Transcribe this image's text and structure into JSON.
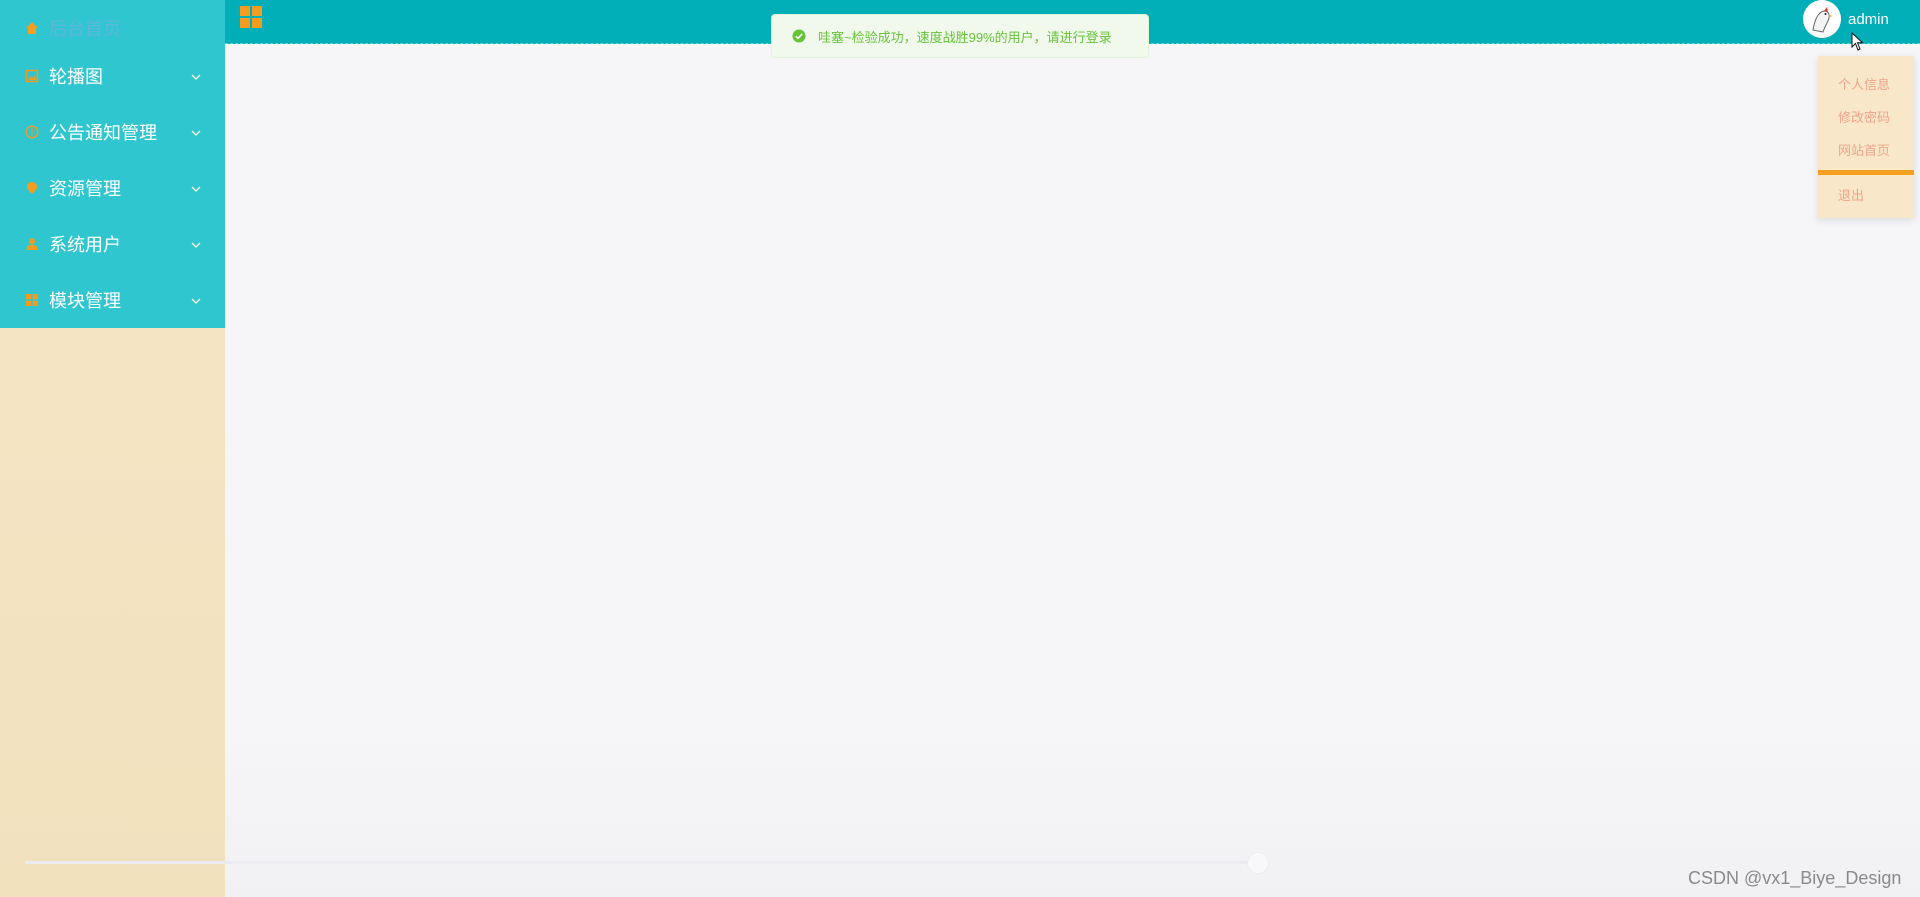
{
  "sidebar": {
    "items": [
      {
        "label": "后台首页",
        "icon": "home-icon"
      },
      {
        "label": "轮播图",
        "icon": "image-icon"
      },
      {
        "label": "公告通知管理",
        "icon": "info-circle-icon"
      },
      {
        "label": "资源管理",
        "icon": "location-pin-icon"
      },
      {
        "label": "系统用户",
        "icon": "user-icon"
      },
      {
        "label": "模块管理",
        "icon": "grid-icon"
      }
    ]
  },
  "header": {
    "title": "…"
  },
  "user": {
    "name": "admin"
  },
  "toast": {
    "text": "哇塞~检验成功，速度战胜99%的用户，请进行登录",
    "status": "success"
  },
  "dropdown": {
    "items": [
      "个人信息",
      "修改密码",
      "网站首页",
      "退出"
    ]
  },
  "watermark": "CSDN @vx1_Biye_Design",
  "colors": {
    "menu_bg": "#2fc6cf",
    "header_bg": "#00aeb8",
    "accent_orange": "#f39c1f",
    "sidebar_bg": "#f5e6c8",
    "toast_text": "#67c23a"
  }
}
